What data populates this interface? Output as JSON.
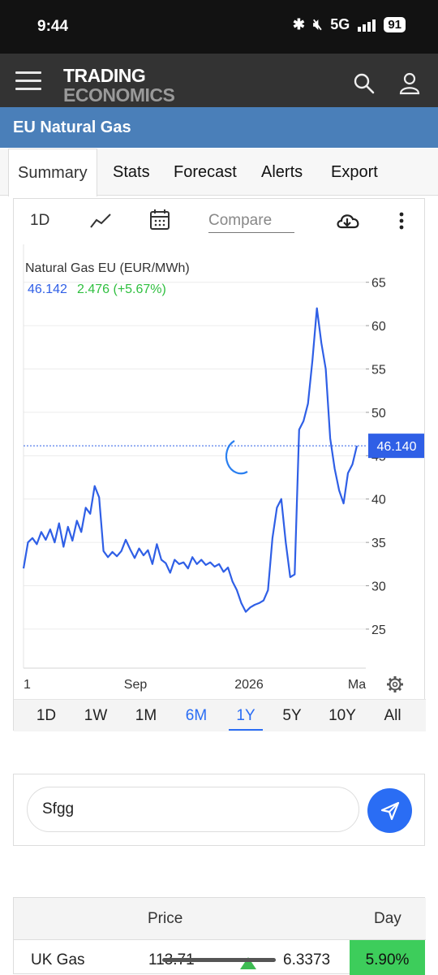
{
  "status_bar": {
    "time": "9:44",
    "network": "5G",
    "battery": "91"
  },
  "app": {
    "logo_line1": "TRADING",
    "logo_line2": "ECONOMICS"
  },
  "page": {
    "title": "EU Natural Gas"
  },
  "tabs": [
    {
      "label": "Summary",
      "active": true
    },
    {
      "label": "Stats"
    },
    {
      "label": "Forecast"
    },
    {
      "label": "Alerts"
    },
    {
      "label": "Export"
    }
  ],
  "chart_toolbar": {
    "interval": "1D",
    "compare_placeholder": "Compare"
  },
  "chart_data": {
    "type": "line",
    "title": "Natural Gas EU (EUR/MWh)",
    "last_value": "46.142",
    "change": "2.476 (+5.67%)",
    "price_tag": "46.140",
    "y_ticks": [
      25,
      30,
      35,
      40,
      45,
      50,
      55,
      60,
      65
    ],
    "ylim": [
      20.5,
      67.5
    ],
    "x_ticks": [
      "1",
      "Sep",
      "2026",
      "Ma"
    ],
    "line_color": "#2f5fe6",
    "series": [
      {
        "values": [
          32.0,
          35.0,
          35.5,
          34.8,
          36.2,
          35.3,
          36.5,
          35.0,
          37.2,
          34.5,
          36.8,
          35.2,
          37.5,
          36.2,
          39.0,
          38.3,
          41.5,
          40.2,
          34.0,
          33.3,
          33.9,
          33.4,
          34.0,
          35.3,
          34.2,
          33.2,
          34.3,
          33.5,
          34.1,
          32.5,
          34.8,
          33.0,
          32.6,
          31.5,
          33.0,
          32.5,
          32.7,
          32.0,
          33.3,
          32.5,
          33.0,
          32.4,
          32.7,
          32.2,
          32.5,
          31.6,
          32.1,
          30.5,
          29.5,
          28.0,
          27.0,
          27.5,
          27.8,
          28.0,
          28.3,
          29.5,
          35.5,
          39.0,
          40.0,
          35.0,
          31.0,
          31.3,
          48.0,
          49.0,
          51.0,
          56.0,
          62.0,
          58.0,
          55.0,
          47.0,
          43.5,
          41.0,
          39.5,
          43.0,
          44.0,
          46.14
        ]
      }
    ]
  },
  "periods": [
    "1D",
    "1W",
    "1M",
    "6M",
    "1Y",
    "5Y",
    "10Y",
    "All"
  ],
  "comment": {
    "value": "Sfgg"
  },
  "table": {
    "headers": {
      "price": "Price",
      "day": "Day"
    },
    "rows": [
      {
        "name": "UK Gas",
        "price": "113.71",
        "change": "6.3373",
        "day": "5.90%"
      }
    ]
  }
}
